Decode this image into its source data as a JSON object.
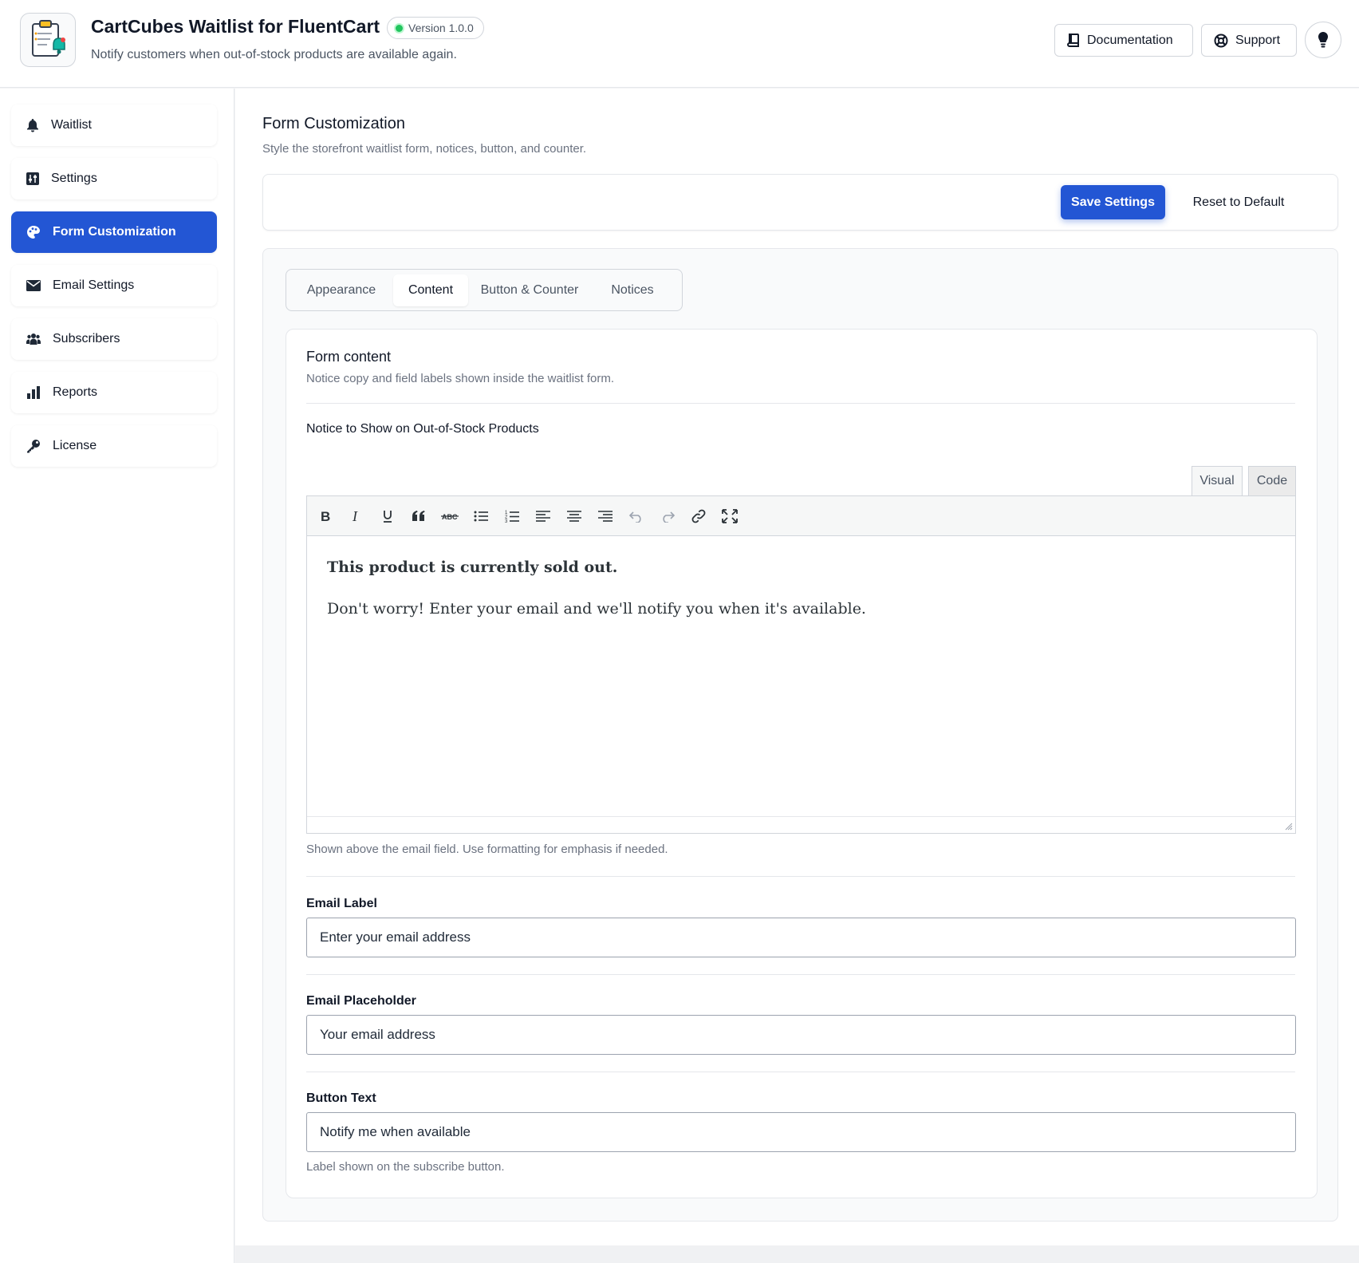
{
  "header": {
    "title": "CartCubes Waitlist for FluentCart",
    "version": "Version 1.0.0",
    "subtitle": "Notify customers when out-of-stock products are available again.",
    "documentation_label": "Documentation",
    "support_label": "Support"
  },
  "sidebar": {
    "items": [
      {
        "label": "Waitlist",
        "icon": "bell-icon"
      },
      {
        "label": "Settings",
        "icon": "sliders-icon"
      },
      {
        "label": "Form Customization",
        "icon": "palette-icon",
        "active": true
      },
      {
        "label": "Email Settings",
        "icon": "envelope-icon"
      },
      {
        "label": "Subscribers",
        "icon": "users-icon"
      },
      {
        "label": "Reports",
        "icon": "bar-chart-icon"
      },
      {
        "label": "License",
        "icon": "key-icon"
      }
    ]
  },
  "page": {
    "title": "Form Customization",
    "subtitle": "Style the storefront waitlist form, notices, button, and counter.",
    "save_label": "Save Settings",
    "reset_label": "Reset to Default"
  },
  "tabs": [
    "Appearance",
    "Content",
    "Button & Counter",
    "Notices"
  ],
  "active_tab": "Content",
  "form_content": {
    "title": "Form content",
    "description": "Notice copy and field labels shown inside the waitlist form.",
    "notice_label": "Notice to Show on Out-of-Stock Products",
    "editor_tabs": {
      "visual": "Visual",
      "code": "Code"
    },
    "notice_heading": "This product is currently sold out.",
    "notice_body": "Don't worry! Enter your email and we'll notify you when it's available.",
    "notice_help": "Shown above the email field. Use formatting for emphasis if needed.",
    "email_label_label": "Email Label",
    "email_label_value": "Enter your email address",
    "email_placeholder_label": "Email Placeholder",
    "email_placeholder_value": "Your email address",
    "button_text_label": "Button Text",
    "button_text_value": "Notify me when available",
    "button_text_help": "Label shown on the subscribe button."
  },
  "colors": {
    "primary": "#2356d4",
    "status_dot": "#22c55e",
    "text": "#111827",
    "muted": "#6b7280"
  }
}
